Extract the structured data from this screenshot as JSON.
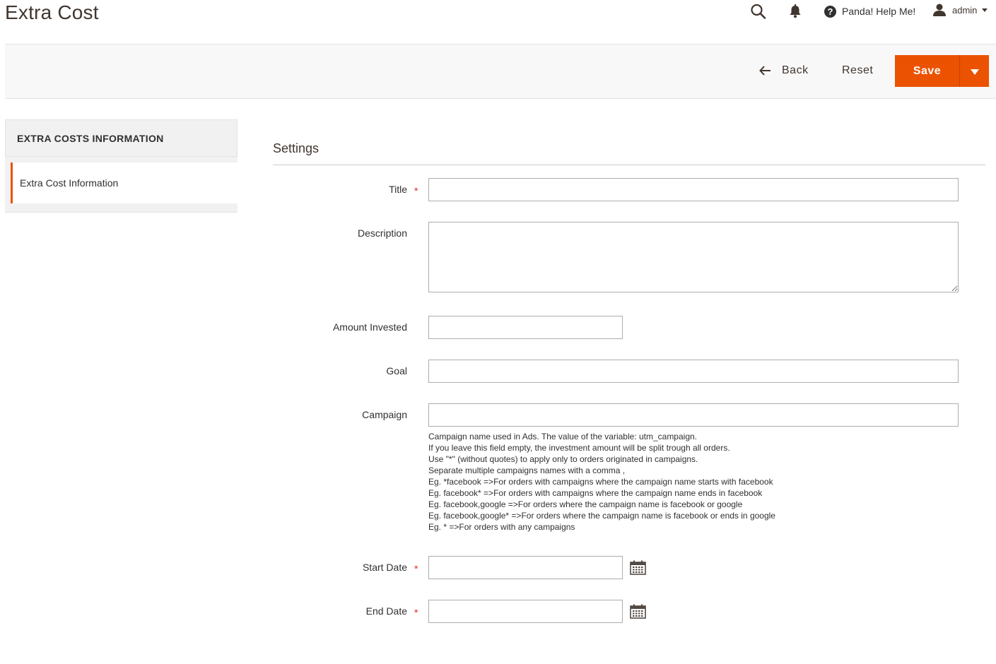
{
  "header": {
    "page_title": "Extra Cost",
    "help_label": "Panda! Help Me!",
    "user_label": "admin"
  },
  "toolbar": {
    "back_label": "Back",
    "reset_label": "Reset",
    "save_label": "Save"
  },
  "sidebar": {
    "heading": "EXTRA COSTS INFORMATION",
    "items": [
      {
        "label": "Extra Cost Information"
      }
    ]
  },
  "form": {
    "section_title": "Settings",
    "fields": {
      "title": {
        "label": "Title",
        "value": "",
        "required": true
      },
      "description": {
        "label": "Description",
        "value": ""
      },
      "amount_invested": {
        "label": "Amount Invested",
        "value": ""
      },
      "goal": {
        "label": "Goal",
        "value": ""
      },
      "campaign": {
        "label": "Campaign",
        "value": "",
        "note": [
          "Campaign name used in Ads. The value of the variable: utm_campaign.",
          "If you leave this field empty, the investment amount will be split trough all orders.",
          "Use \"*\" (without quotes) to apply only to orders originated in campaigns.",
          "Separate multiple campaigns names with a comma ,",
          "Eg. *facebook =>For orders with campaigns where the campaign name starts with facebook",
          "Eg. facebook* =>For orders with campaigns where the campaign name ends in facebook",
          "Eg. facebook,google =>For orders where the campaign name is facebook or google",
          "Eg. facebook,google* =>For orders where the campaign name is facebook or ends in google",
          "Eg. * =>For orders with any campaigns"
        ]
      },
      "start_date": {
        "label": "Start Date",
        "value": "",
        "required": true
      },
      "end_date": {
        "label": "End Date",
        "value": "",
        "required": true
      }
    },
    "required_marker": "*"
  },
  "colors": {
    "accent": "#eb5202",
    "required": "#e22626",
    "text": "#303030"
  }
}
